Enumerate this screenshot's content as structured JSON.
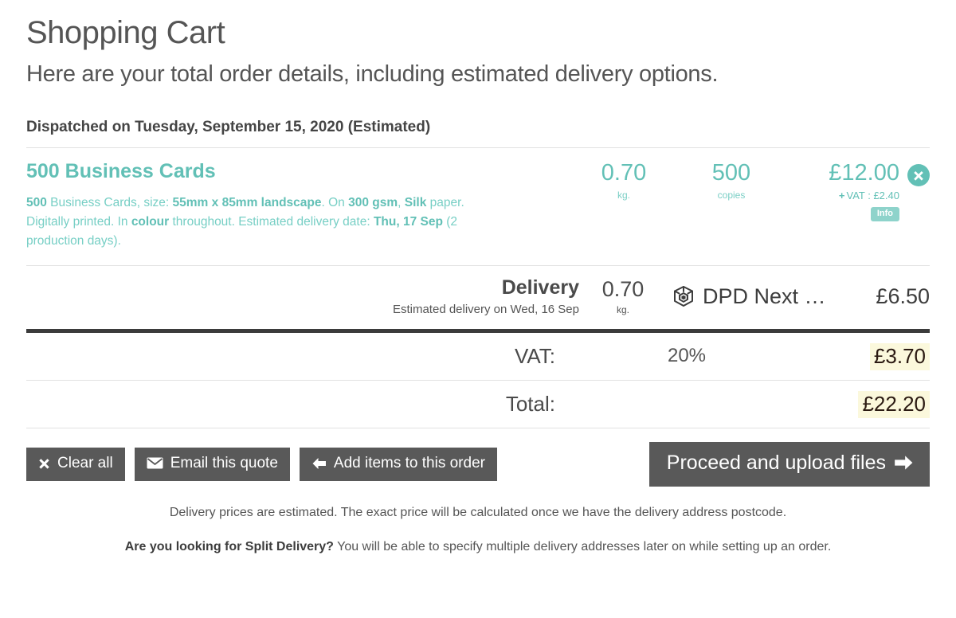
{
  "header": {
    "title": "Shopping Cart",
    "subtitle": "Here are your total order details, including estimated delivery options.",
    "dispatch": "Dispatched on Tuesday, September 15, 2020 (Estimated)"
  },
  "item": {
    "title": "500 Business Cards",
    "desc_parts": [
      {
        "t": "500",
        "b": true
      },
      {
        "t": " Business Cards, size: ",
        "b": false
      },
      {
        "t": "55mm x 85mm landscape",
        "b": true
      },
      {
        "t": ". On ",
        "b": false
      },
      {
        "t": "300 gsm",
        "b": true
      },
      {
        "t": ", ",
        "b": false
      },
      {
        "t": "Silk",
        "b": true
      },
      {
        "t": " paper. Digitally printed. In ",
        "b": false
      },
      {
        "t": "colour",
        "b": true
      },
      {
        "t": " throughout. Estimated delivery date: ",
        "b": false
      },
      {
        "t": "Thu, 17 Sep",
        "b": true
      },
      {
        "t": " (2 production days).",
        "b": false
      }
    ],
    "weight": "0.70",
    "weight_unit": "kg.",
    "quantity": "500",
    "quantity_unit": "copies",
    "price": "£12.00",
    "vat_note_plus": "+",
    "vat_note": "VAT : £2.40",
    "info_badge": "Info",
    "remove_label": "Remove item"
  },
  "delivery": {
    "label": "Delivery",
    "sublabel": "Estimated delivery on Wed, 16 Sep",
    "weight": "0.70",
    "weight_unit": "kg.",
    "carrier": "DPD Next …",
    "price": "£6.50"
  },
  "vat": {
    "label": "VAT:",
    "rate": "20%",
    "amount": "£3.70"
  },
  "total": {
    "label": "Total:",
    "mid": "",
    "amount": "£22.20"
  },
  "buttons": {
    "clear_all": "Clear all",
    "email_quote": "Email this quote",
    "add_items": "Add items to this order",
    "proceed": "Proceed and upload files"
  },
  "notes": {
    "delivery_note": "Delivery prices are estimated. The exact price will be calculated once we have the delivery address postcode.",
    "split_strong": "Are you looking for Split Delivery?",
    "split_rest": " You will be able to specify multiple delivery addresses later on while setting up an order."
  },
  "colors": {
    "teal": "#62c0b6",
    "teal_light": "#8ed3cb",
    "dark_gray": "#595959",
    "highlight_bg": "#fbf8dc",
    "rule": "#e2e2e2",
    "rule_strong": "#3b3b3b"
  }
}
